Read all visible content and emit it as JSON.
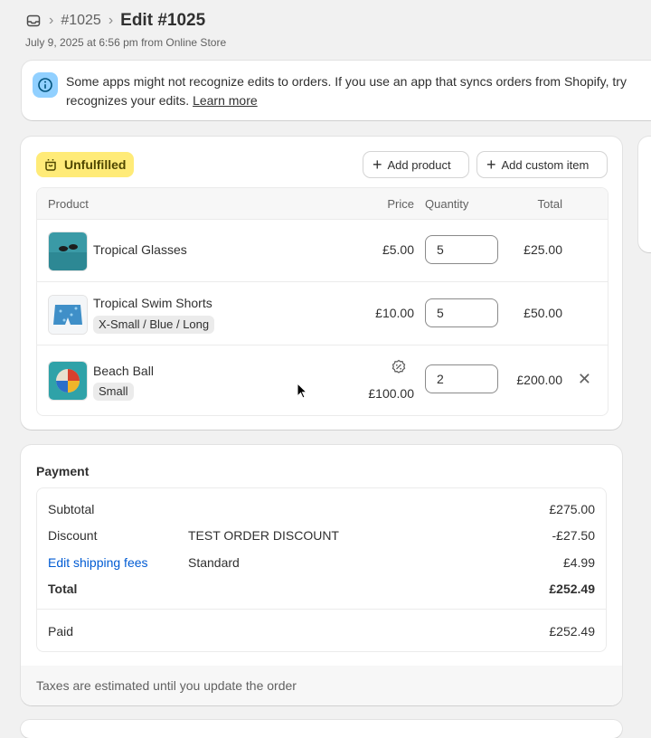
{
  "breadcrumb": {
    "order_ref": "#1025",
    "title": "Edit #1025",
    "subtitle": "July 9, 2025 at 6:56 pm from Online Store"
  },
  "banner": {
    "line1": "Some apps might not recognize edits to orders. If you use an app that syncs orders from Shopify, try",
    "line2": "recognizes your edits.",
    "link": "Learn more"
  },
  "items": {
    "status_badge": "Unfulfilled",
    "add_product_label": "Add product",
    "add_custom_label": "Add custom item",
    "columns": {
      "product": "Product",
      "price": "Price",
      "quantity": "Quantity",
      "total": "Total"
    },
    "rows": [
      {
        "name": "Tropical Glasses",
        "variant": "",
        "price": "£5.00",
        "quantity": "5",
        "total": "£25.00"
      },
      {
        "name": "Tropical Swim Shorts",
        "variant": "X-Small / Blue / Long",
        "price": "£10.00",
        "quantity": "5",
        "total": "£50.00"
      },
      {
        "name": "Beach Ball",
        "variant": "Small",
        "price": "£100.00",
        "quantity": "2",
        "total": "£200.00"
      }
    ]
  },
  "payment": {
    "title": "Payment",
    "subtotal_label": "Subtotal",
    "subtotal_value": "£275.00",
    "discount_label": "Discount",
    "discount_code": "TEST ORDER DISCOUNT",
    "discount_value": "-£27.50",
    "shipping_link": "Edit shipping fees",
    "shipping_method": "Standard",
    "shipping_value": "£4.99",
    "total_label": "Total",
    "total_value": "£252.49",
    "paid_label": "Paid",
    "paid_value": "£252.49",
    "footer_note": "Taxes are estimated until you update the order"
  },
  "colors": {
    "badge_bg": "#ffeb78",
    "link": "#005bd3",
    "info_icon_bg": "#91d0ff"
  }
}
